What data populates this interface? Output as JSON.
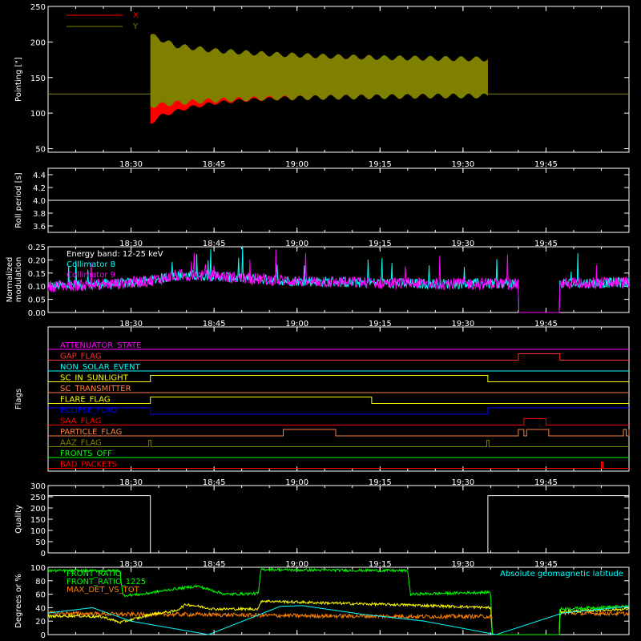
{
  "chart_data": [
    {
      "id": "pointing",
      "type": "line",
      "ylabel": "Pointing [\"]",
      "ylim": [
        45,
        250
      ],
      "yticks": [
        50,
        100,
        150,
        200,
        250
      ],
      "xticks": [
        "18:30",
        "18:45",
        "19:00",
        "19:15",
        "19:30",
        "19:45"
      ],
      "xlim_min": [
        1095,
        1200
      ],
      "xtick_min": [
        1110,
        1125,
        1140,
        1155,
        1170,
        1185
      ],
      "baseline": 127,
      "spin_start_min": 1113.5,
      "spin_end_min": 1174.5,
      "legend": [
        {
          "name": "X",
          "color": "#ff0000"
        },
        {
          "name": "Y",
          "color": "#808000"
        }
      ],
      "series": [
        {
          "name": "X",
          "color": "#ff0000",
          "upper": [
            [
              1113.5,
              200
            ],
            [
              1120,
              186
            ],
            [
              1130,
              180
            ],
            [
              1140,
              178
            ],
            [
              1150,
              176
            ],
            [
              1160,
              175
            ],
            [
              1170,
              174
            ],
            [
              1174.5,
              174
            ]
          ],
          "lower": [
            [
              1113.5,
              85
            ],
            [
              1115,
              95
            ],
            [
              1120,
              107
            ],
            [
              1125,
              114
            ],
            [
              1130,
              118
            ],
            [
              1140,
              122
            ],
            [
              1150,
              124
            ],
            [
              1160,
              125
            ],
            [
              1170,
              126
            ],
            [
              1174.5,
              126
            ]
          ]
        },
        {
          "name": "Y",
          "color": "#808000",
          "upper": [
            [
              1113.5,
              210
            ],
            [
              1118,
              195
            ],
            [
              1125,
              188
            ],
            [
              1135,
              183
            ],
            [
              1145,
              180
            ],
            [
              1155,
              178
            ],
            [
              1165,
              177
            ],
            [
              1174.5,
              176
            ]
          ],
          "lower": [
            [
              1113.5,
              110
            ],
            [
              1118,
              114
            ],
            [
              1125,
              118
            ],
            [
              1135,
              121
            ],
            [
              1145,
              122
            ],
            [
              1155,
              123
            ],
            [
              1165,
              124
            ],
            [
              1174.5,
              124
            ]
          ]
        }
      ]
    },
    {
      "id": "roll",
      "type": "line",
      "ylabel": "Roll period [s]",
      "ylim": [
        3.5,
        4.5
      ],
      "yticks": [
        "3.6",
        "3.8",
        "4.0",
        "4.2",
        "4.4"
      ],
      "yticks_val": [
        3.6,
        3.8,
        4.0,
        4.2,
        4.4
      ],
      "xticks": [
        "18:30",
        "18:45",
        "19:00",
        "19:15",
        "19:30",
        "19:45"
      ],
      "series": [
        {
          "name": "Roll period",
          "color": "#ffffff",
          "points": [
            [
              1095,
              4.0
            ],
            [
              1200,
              4.0
            ]
          ]
        }
      ]
    },
    {
      "id": "modulation",
      "type": "line",
      "ylabel": "Normalized\nmodulation",
      "ylim": [
        0,
        0.25
      ],
      "yticks": [
        "0.00",
        "0.05",
        "0.10",
        "0.15",
        "0.20",
        "0.25"
      ],
      "yticks_val": [
        0,
        0.05,
        0.1,
        0.15,
        0.2,
        0.25
      ],
      "xticks": [
        "18:30",
        "18:45",
        "19:00",
        "19:15",
        "19:30",
        "19:45"
      ],
      "annotation": "Energy band: 12-25 keV",
      "legend": [
        {
          "name": "Collimator 8",
          "color": "#00ffff"
        },
        {
          "name": "Collimator 9",
          "color": "#ff00ff"
        }
      ],
      "gap_min": [
        1180,
        1187.5
      ],
      "level_profile": [
        [
          1095,
          0.1
        ],
        [
          1108,
          0.11
        ],
        [
          1113,
          0.12
        ],
        [
          1118,
          0.14
        ],
        [
          1125,
          0.14
        ],
        [
          1130,
          0.13
        ],
        [
          1140,
          0.12
        ],
        [
          1160,
          0.11
        ],
        [
          1175,
          0.11
        ],
        [
          1180,
          0.11
        ],
        [
          1187.5,
          0.11
        ],
        [
          1200,
          0.115
        ]
      ],
      "noise": 0.02
    },
    {
      "id": "flags",
      "type": "line",
      "ylabel": "Flags",
      "xticks": [
        "18:30",
        "18:45",
        "19:00",
        "19:15",
        "19:30",
        "19:45"
      ],
      "flags": [
        {
          "name": "ATTENUATOR_STATE",
          "color": "#ff00ff",
          "high": []
        },
        {
          "name": "GAP_FLAG",
          "color": "#ff3030",
          "high": [
            [
              1180,
              1187.5
            ]
          ]
        },
        {
          "name": "NON_SOLAR_EVENT",
          "color": "#00ffff",
          "high": []
        },
        {
          "name": "SC_IN_SUNLIGHT",
          "color": "#ffff00",
          "high": [
            [
              1113.5,
              1174.5
            ]
          ]
        },
        {
          "name": "SC_TRANSMITTER",
          "color": "#ff8040",
          "high": []
        },
        {
          "name": "FLARE_FLAG",
          "color": "#ffff00",
          "high": [
            [
              1113.5,
              1153.5
            ]
          ]
        },
        {
          "name": "ECLIPSE_FLAG",
          "color": "#0000ff",
          "low": [
            [
              1113.5,
              1174.5
            ]
          ]
        },
        {
          "name": "SAA_FLAG",
          "color": "#ff0000",
          "high": [
            [
              1181,
              1185
            ]
          ]
        },
        {
          "name": "PARTICLE_FLAG",
          "color": "#ff8040",
          "high": [
            [
              1137.5,
              1147
            ],
            [
              1180,
              1181
            ],
            [
              1181.5,
              1185.5
            ],
            [
              1199,
              1199.5
            ],
            [
              1200,
              1200.8
            ]
          ]
        },
        {
          "name": "AAZ_FLAG",
          "color": "#808000",
          "high": [
            [
              1113.2,
              1113.6
            ],
            [
              1174.3,
              1174.7
            ]
          ]
        },
        {
          "name": "FRONTS_OFF",
          "color": "#00ff00",
          "high": []
        },
        {
          "name": "BAD_PACKETS",
          "color": "#ff0000",
          "high": [
            [
              1195,
              1195.3
            ]
          ]
        }
      ]
    },
    {
      "id": "quality",
      "type": "line",
      "ylabel": "Quality",
      "ylim": [
        0,
        300
      ],
      "yticks": [
        0,
        50,
        100,
        150,
        200,
        250,
        300
      ],
      "xticks": [
        "18:30",
        "18:45",
        "19:00",
        "19:15",
        "19:30",
        "19:45"
      ],
      "series": [
        {
          "name": "Quality",
          "color": "#ffffff",
          "points": [
            [
              1095,
              255
            ],
            [
              1113.5,
              255
            ],
            [
              1113.5,
              0
            ],
            [
              1174.5,
              0
            ],
            [
              1174.5,
              255
            ],
            [
              1200,
              255
            ]
          ]
        }
      ]
    },
    {
      "id": "ratios",
      "type": "line",
      "ylabel": "Degrees or %",
      "ylim": [
        0,
        100
      ],
      "yticks": [
        0,
        20,
        40,
        60,
        80,
        100
      ],
      "xticks": [
        "18:30",
        "18:45",
        "19:00",
        "19:15",
        "19:30",
        "19:45"
      ],
      "legend": [
        {
          "name": "FRONT_RATIO",
          "color": "#00ff00"
        },
        {
          "name": "FRONT_RATIO_1225",
          "color": "#00ff00"
        },
        {
          "name": "MAX_DET_VS_TOT",
          "color": "#ff8000"
        }
      ],
      "right_legend": {
        "name": "Absolute geomagnetic latitude",
        "color": "#00ffff"
      },
      "series": [
        {
          "name": "FRONT_RATIO",
          "color": "#00ff00",
          "noise": 2,
          "points": [
            [
              1095,
              95
            ],
            [
              1108,
              95
            ],
            [
              1108.5,
              58
            ],
            [
              1112,
              60
            ],
            [
              1118,
              68
            ],
            [
              1122,
              72
            ],
            [
              1127,
              60
            ],
            [
              1133,
              61
            ],
            [
              1133.5,
              97
            ],
            [
              1140,
              96
            ],
            [
              1160,
              95
            ],
            [
              1160.5,
              60
            ],
            [
              1175,
              63
            ],
            [
              1175.3,
              0
            ],
            [
              1187.4,
              0
            ],
            [
              1187.5,
              38
            ],
            [
              1200,
              42
            ]
          ]
        },
        {
          "name": "FRONT_RATIO_1225",
          "color": "#ffff00",
          "noise": 2,
          "points": [
            [
              1095,
              27
            ],
            [
              1100,
              28
            ],
            [
              1105,
              26
            ],
            [
              1108,
              18
            ],
            [
              1112,
              26
            ],
            [
              1113.5,
              30
            ],
            [
              1118,
              35
            ],
            [
              1120,
              45
            ],
            [
              1125,
              38
            ],
            [
              1133,
              38
            ],
            [
              1133.5,
              50
            ],
            [
              1145,
              47
            ],
            [
              1160,
              44
            ],
            [
              1175,
              40
            ],
            [
              1175.3,
              0
            ],
            [
              1187.4,
              0
            ],
            [
              1187.5,
              34
            ],
            [
              1200,
              38
            ]
          ]
        },
        {
          "name": "MAX_DET_VS_TOT",
          "color": "#ff8000",
          "noise": 3,
          "points": [
            [
              1095,
              32
            ],
            [
              1110,
              30
            ],
            [
              1120,
              30
            ],
            [
              1140,
              28
            ],
            [
              1160,
              27
            ],
            [
              1175,
              27
            ],
            [
              1175.3,
              0
            ],
            [
              1187.4,
              0
            ],
            [
              1187.5,
              32
            ],
            [
              1200,
              31
            ]
          ]
        },
        {
          "name": "Absolute geomagnetic latitude",
          "color": "#00ffff",
          "noise": 0,
          "points": [
            [
              1095,
              32
            ],
            [
              1103,
              40
            ],
            [
              1110,
              20
            ],
            [
              1124,
              0
            ],
            [
              1137,
              42
            ],
            [
              1141,
              43
            ],
            [
              1152,
              30
            ],
            [
              1163,
              20
            ],
            [
              1176,
              0
            ],
            [
              1188,
              32
            ],
            [
              1200,
              42
            ]
          ]
        }
      ]
    }
  ]
}
